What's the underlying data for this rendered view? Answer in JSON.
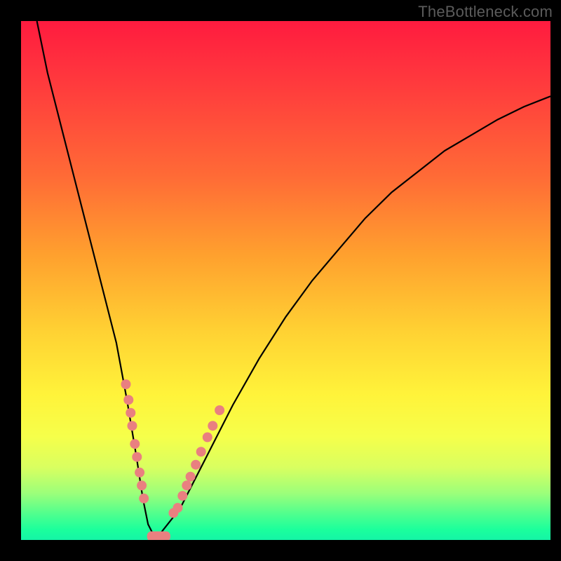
{
  "watermark": "TheBottleneck.com",
  "colors": {
    "dot": "#e98080",
    "curve": "#000000",
    "frame": "#000000"
  },
  "chart_data": {
    "type": "line",
    "title": "",
    "xlabel": "",
    "ylabel": "",
    "xlim": [
      0,
      100
    ],
    "ylim": [
      0,
      100
    ],
    "grid": false,
    "legend": false,
    "series": [
      {
        "name": "bottleneck-curve",
        "x": [
          3,
          5,
          8,
          10,
          12,
          14,
          16,
          18,
          20,
          21.8,
          23,
          24,
          25,
          25.8,
          30,
          35,
          40,
          45,
          50,
          55,
          60,
          65,
          70,
          75,
          80,
          85,
          90,
          95,
          100
        ],
        "y": [
          100,
          90,
          78,
          70,
          62,
          54,
          46,
          38,
          27,
          16,
          8,
          3,
          1,
          0.6,
          6,
          16,
          26,
          35,
          43,
          50,
          56,
          62,
          67,
          71,
          75,
          78,
          81,
          83.5,
          85.5
        ]
      }
    ],
    "markers": {
      "name": "highlighted-points",
      "color": "#e98080",
      "points": [
        {
          "x": 19.8,
          "y": 30
        },
        {
          "x": 20.3,
          "y": 27
        },
        {
          "x": 20.7,
          "y": 24.5
        },
        {
          "x": 21.0,
          "y": 22
        },
        {
          "x": 21.5,
          "y": 18.5
        },
        {
          "x": 21.9,
          "y": 16
        },
        {
          "x": 22.4,
          "y": 13
        },
        {
          "x": 22.8,
          "y": 10.5
        },
        {
          "x": 23.2,
          "y": 8
        },
        {
          "x": 28.8,
          "y": 5.2
        },
        {
          "x": 29.6,
          "y": 6.2
        },
        {
          "x": 30.5,
          "y": 8.5
        },
        {
          "x": 31.3,
          "y": 10.5
        },
        {
          "x": 32.0,
          "y": 12.2
        },
        {
          "x": 33.0,
          "y": 14.5
        },
        {
          "x": 34.0,
          "y": 17
        },
        {
          "x": 35.2,
          "y": 19.8
        },
        {
          "x": 36.2,
          "y": 22
        },
        {
          "x": 37.5,
          "y": 25
        }
      ]
    },
    "bottom_segment": {
      "name": "valley-floor",
      "color": "#e98080",
      "x_start": 23.8,
      "x_end": 28.2,
      "y": 0.7
    }
  }
}
